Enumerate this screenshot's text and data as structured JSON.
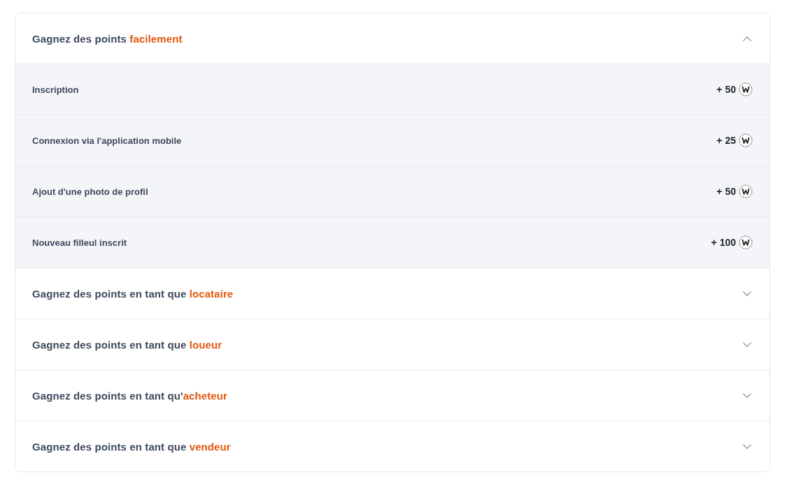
{
  "sections": [
    {
      "title": "Gagnez des points ",
      "highlight": "facilement",
      "expanded": true,
      "items": [
        {
          "label": "Inscription",
          "points": "+ 50"
        },
        {
          "label": "Connexion via l'application mobile",
          "points": "+ 25"
        },
        {
          "label": "Ajout d'une photo de profil",
          "points": "+ 50"
        },
        {
          "label": "Nouveau filleul inscrit",
          "points": "+ 100"
        }
      ]
    },
    {
      "title": "Gagnez des points en tant que ",
      "highlight": "locataire",
      "expanded": false
    },
    {
      "title": "Gagnez des points en tant que ",
      "highlight": "loueur",
      "expanded": false
    },
    {
      "title": "Gagnez des points en tant qu'",
      "highlight": "acheteur",
      "expanded": false
    },
    {
      "title": "Gagnez des points en tant que ",
      "highlight": "vendeur",
      "expanded": false
    }
  ]
}
